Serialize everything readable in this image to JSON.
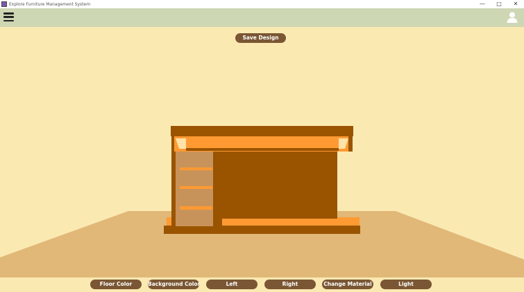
{
  "window": {
    "title": "Explore Furniture Management System",
    "minimize_glyph": "—",
    "maximize_glyph": "□",
    "close_glyph": "✕"
  },
  "header": {
    "menu_icon": "hamburger-menu-icon",
    "user_icon": "user-account-icon"
  },
  "actions": {
    "save_design": "Save Design"
  },
  "toolbar": {
    "buttons": [
      "Floor Color",
      "Background Color",
      "Left",
      "Right",
      "Change Material",
      "Light"
    ]
  },
  "scene": {
    "background_color": "#fbe9b2",
    "floor_color": "#e1b877",
    "furniture_color": "#9a5400",
    "furniture_light_color": "#ff9a33",
    "shelf_panel_color": "#c8935a",
    "button_color": "#7a5634"
  }
}
